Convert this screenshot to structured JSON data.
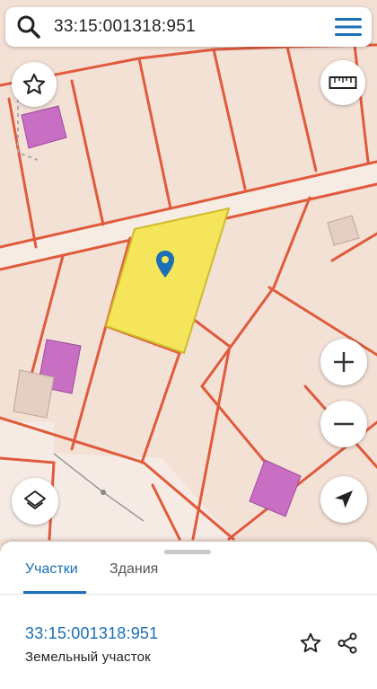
{
  "search": {
    "query": "33:15:001318:951"
  },
  "tabs": [
    {
      "label": "Участки",
      "active": true
    },
    {
      "label": "Здания",
      "active": false
    }
  ],
  "parcel": {
    "cadastral_number": "33:15:001318:951",
    "type": "Земельный участок"
  },
  "colors": {
    "map_background": "#f3e1d6",
    "parcel_border": "#e05a3c",
    "selected_parcel": "#f4e55a",
    "building": "#c86fc4",
    "accent": "#1a6fb5"
  },
  "icons": {
    "search": "search-icon",
    "menu": "menu-icon",
    "favorite": "star-icon",
    "ruler": "ruler-icon",
    "zoom_in": "plus-icon",
    "zoom_out": "minus-icon",
    "layers": "layers-icon",
    "locate": "navigation-arrow-icon",
    "marker": "map-pin-icon",
    "share": "share-icon"
  }
}
